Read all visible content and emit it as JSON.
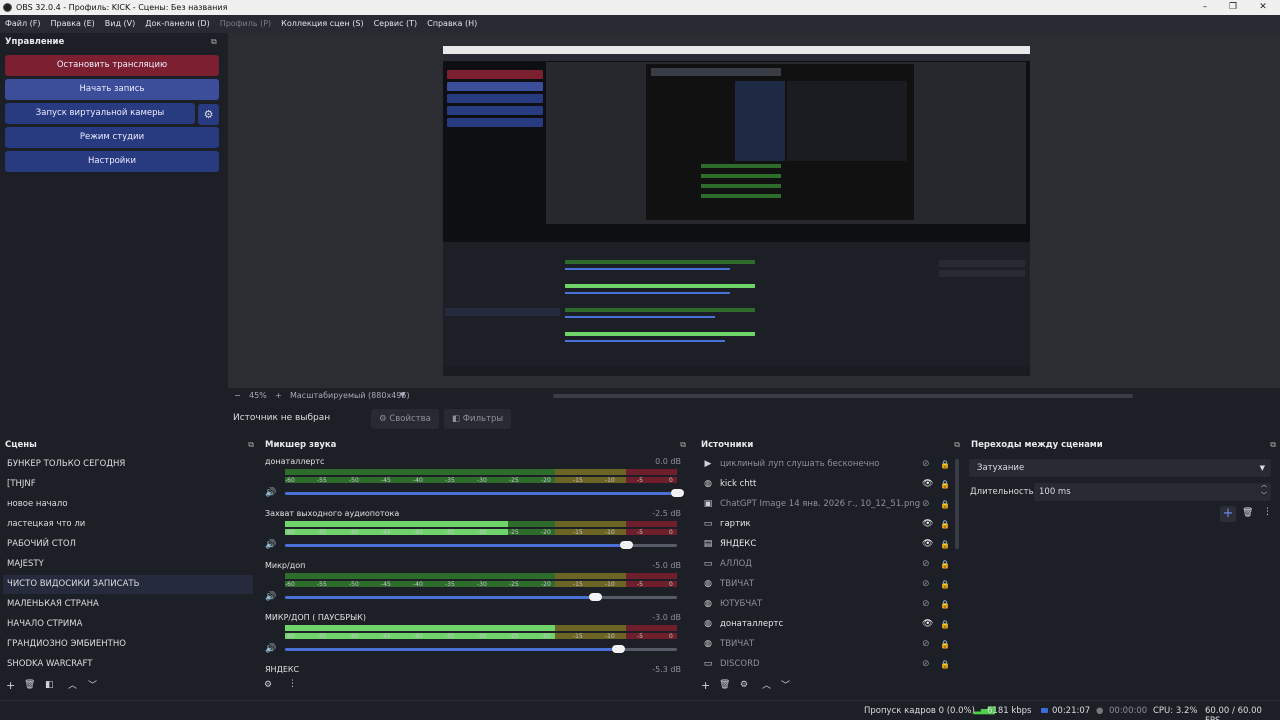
{
  "window": {
    "title": "OBS 32.0.4 - Профиль: KICK - Сцены: Без названия",
    "min": "–",
    "max": "❐",
    "close": "✕"
  },
  "menu": [
    {
      "label": "Файл (F)",
      "enabled": true
    },
    {
      "label": "Правка (E)",
      "enabled": true
    },
    {
      "label": "Вид (V)",
      "enabled": true
    },
    {
      "label": "Док-панели (D)",
      "enabled": true
    },
    {
      "label": "Профиль (P)",
      "enabled": false
    },
    {
      "label": "Коллекция сцен (S)",
      "enabled": true
    },
    {
      "label": "Сервис (T)",
      "enabled": true
    },
    {
      "label": "Справка (H)",
      "enabled": true
    }
  ],
  "controls": {
    "title": "Управление",
    "stop_stream": "Остановить трансляцию",
    "start_record": "Начать запись",
    "start_vcam": "Запуск виртуальной камеры",
    "studio_mode": "Режим студии",
    "settings": "Настройки"
  },
  "preview": {
    "zoom": "45%",
    "scale_mode": "Масштабируемый (880x495)"
  },
  "source_toolbar": {
    "label": "Источник не выбран",
    "properties": "Свойства",
    "filters": "Фильтры"
  },
  "scenes": {
    "title": "Сцены",
    "items": [
      "БУНКЕР ТОЛЬКО СЕГОДНЯ",
      "[THJNF",
      "новое начало",
      "ластецкая что ли",
      "РАБОЧИЙ СТОЛ",
      "MAJESTY",
      "ЧИСТО ВИДОСИКИ ЗАПИСАТЬ",
      "МАЛЕНЬКАЯ СТРАНА",
      "НАЧАЛО СТРИМА",
      "ГРАНДИОЗНО ЭМБИЕНТНО",
      "SHODKA WARCRAFT"
    ],
    "selected_index": 6
  },
  "mixer": {
    "title": "Микшер звука",
    "ticks": [
      "-60",
      "-55",
      "-50",
      "-45",
      "-40",
      "-35",
      "-30",
      "-25",
      "-20",
      "-15",
      "-10",
      "-5",
      "0"
    ],
    "channels": [
      {
        "name": "донаталлертс",
        "db": "0.0 dB",
        "level": 0,
        "volume": 1.0
      },
      {
        "name": "Захват выходного аудиопотока",
        "db": "-2.5 dB",
        "level": 0.57,
        "volume": 0.87
      },
      {
        "name": "Микр/доп",
        "db": "-5.0 dB",
        "level": 0.0,
        "volume": 0.79
      },
      {
        "name": "МИКР/ДОП ( ПАУСБРЫК)",
        "db": "-3.0 dB",
        "level": 0.69,
        "volume": 0.85
      },
      {
        "name": "ЯНДЕКС",
        "db": "-5.3 dB",
        "level": 0,
        "volume": 0.78
      }
    ]
  },
  "sources": {
    "title": "Источники",
    "items": [
      {
        "label": "циклиный луп слушать бесконечно",
        "icon": "▶",
        "visible": false,
        "locked": true
      },
      {
        "label": "kick chtt",
        "icon": "◍",
        "visible": true,
        "locked": true
      },
      {
        "label": "ChatGPT Image 14 янв. 2026 г., 10_12_51.png",
        "icon": "▣",
        "visible": false,
        "locked": true
      },
      {
        "label": "гартик",
        "icon": "▭",
        "visible": true,
        "locked": true
      },
      {
        "label": "ЯНДЕКС",
        "icon": "▤",
        "visible": true,
        "locked": true
      },
      {
        "label": "АЛЛОД",
        "icon": "▭",
        "visible": false,
        "locked": true
      },
      {
        "label": "ТВИЧАТ",
        "icon": "◍",
        "visible": false,
        "locked": true
      },
      {
        "label": "ЮТУБЧАТ",
        "icon": "◍",
        "visible": false,
        "locked": true
      },
      {
        "label": "донаталлертс",
        "icon": "◍",
        "visible": true,
        "locked": true
      },
      {
        "label": "ТВИЧАТ",
        "icon": "◍",
        "visible": false,
        "locked": true
      },
      {
        "label": "DISCORD",
        "icon": "▭",
        "visible": false,
        "locked": true
      }
    ]
  },
  "transitions": {
    "title": "Переходы между сценами",
    "selected": "Затухание",
    "duration_label": "Длительность",
    "duration_value": "100 ms"
  },
  "status": {
    "dropped": "Пропуск кадров 0 (0.0%)",
    "bitrate": "6181 kbps",
    "stream_time": "00:21:07",
    "record_time": "00:00:00",
    "cpu": "CPU: 3.2%",
    "fps": "60.00 / 60.00 FPS"
  },
  "colors": {
    "stop": "#7c1f30",
    "accent": "#283a80",
    "meter_green": "#6ed46a"
  }
}
